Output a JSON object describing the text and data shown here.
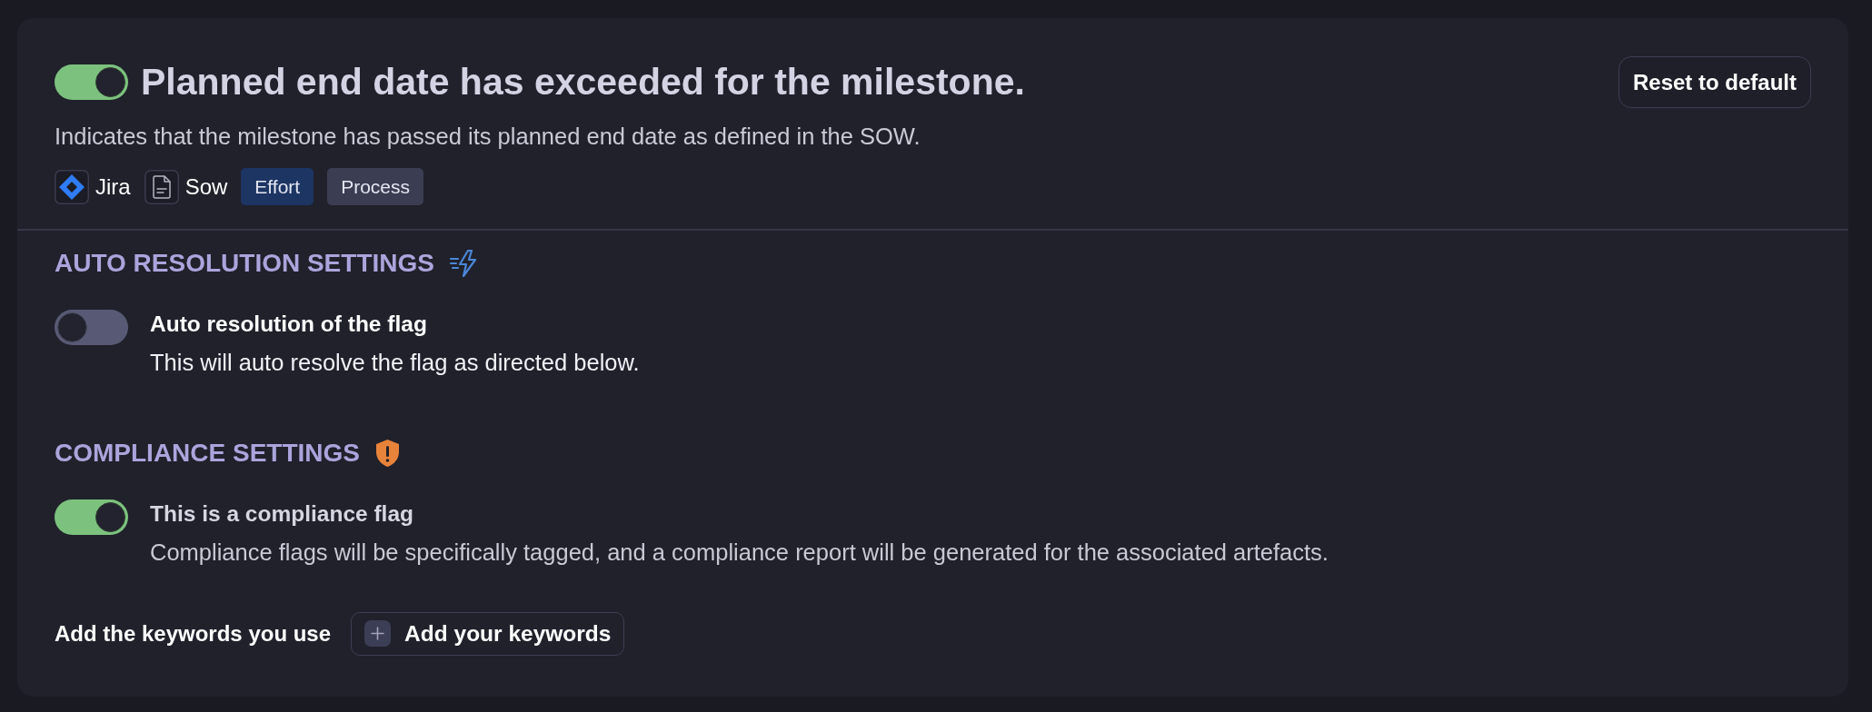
{
  "rule": {
    "enabled": true,
    "title": "Planned end date has exceeded for the milestone.",
    "description": "Indicates that the milestone has passed its planned end date as defined in the SOW.",
    "sources": [
      {
        "kind": "jira",
        "label": "Jira"
      },
      {
        "kind": "document",
        "label": "Sow"
      }
    ],
    "tags": [
      {
        "label": "Effort",
        "color": "#1d3563"
      },
      {
        "label": "Process",
        "color": "#3b3d52"
      }
    ]
  },
  "reset_button": "Reset to default",
  "auto_resolution": {
    "heading": "AUTO RESOLUTION SETTINGS",
    "setting": {
      "on": false,
      "title": "Auto resolution of the flag",
      "description": "This will auto resolve the flag as directed below."
    }
  },
  "compliance": {
    "heading": "COMPLIANCE SETTINGS",
    "setting": {
      "on": true,
      "title": "This is a compliance flag",
      "description": "Compliance flags will be specifically tagged, and a compliance report will be generated for the associated artefacts."
    },
    "keywords": {
      "label": "Add the keywords you use",
      "button": "Add your keywords"
    }
  }
}
